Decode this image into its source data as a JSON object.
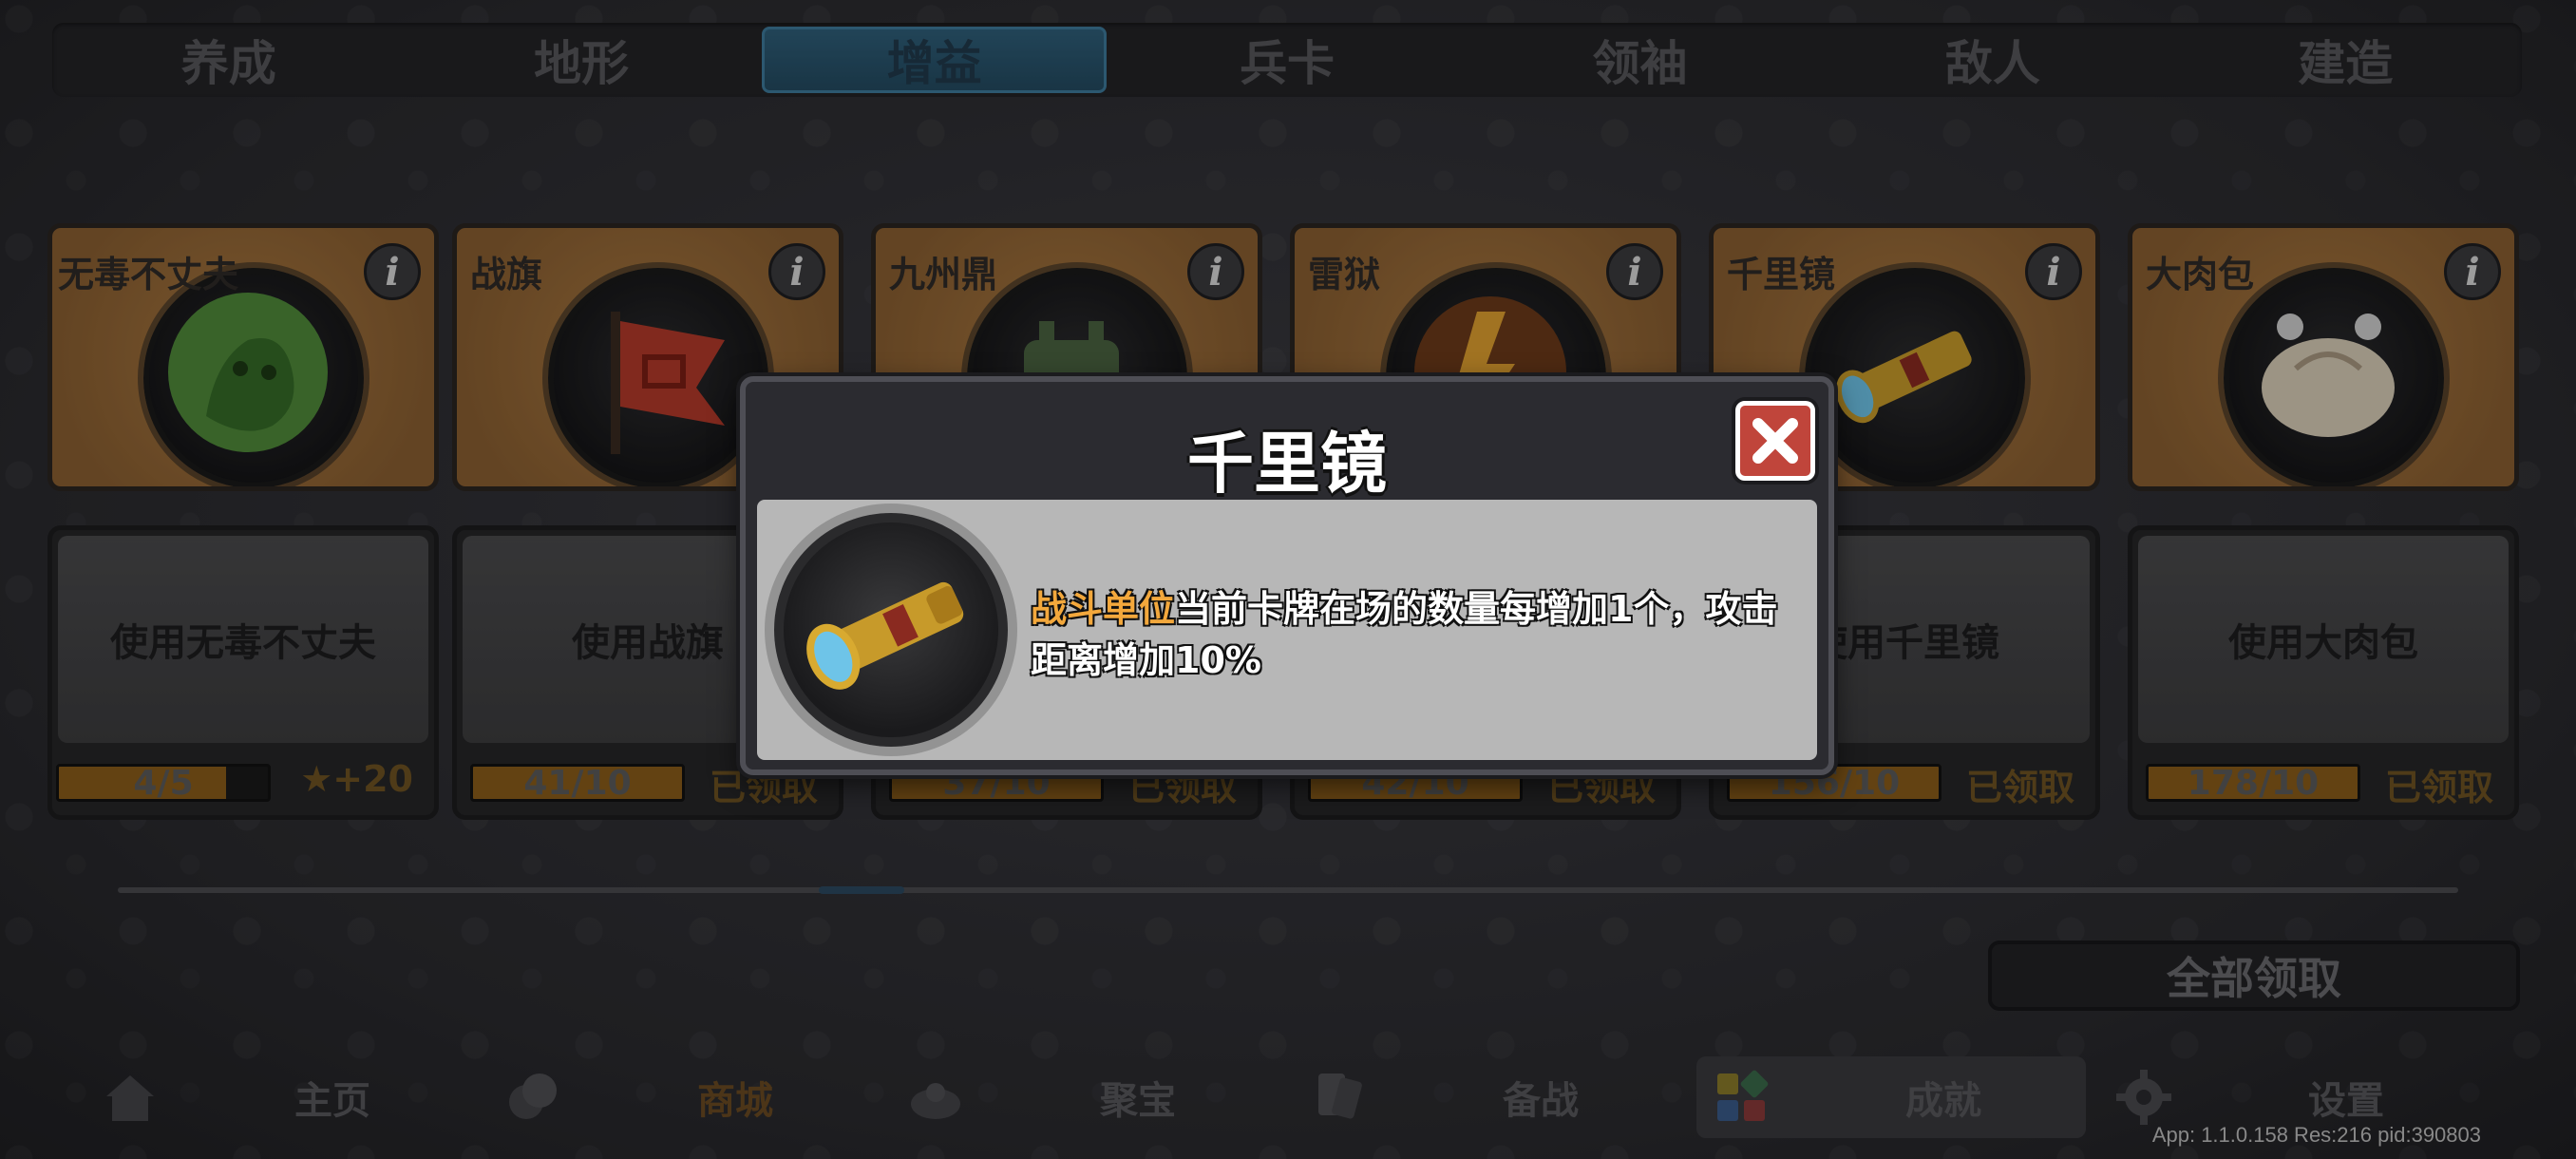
{
  "tabs": [
    {
      "label": "养成"
    },
    {
      "label": "地形"
    },
    {
      "label": "增益",
      "active": true
    },
    {
      "label": "兵卡"
    },
    {
      "label": "领袖"
    },
    {
      "label": "敌人"
    },
    {
      "label": "建造"
    }
  ],
  "cards": [
    {
      "name": "无毒不丈夫",
      "use_label": "使用无毒不丈夫",
      "progress_text": "4/5",
      "progress": 0.8,
      "reward": "+20",
      "status": ""
    },
    {
      "name": "战旗",
      "use_label": "使用战旗",
      "progress_text": "41/10",
      "progress": 1.0,
      "status": "已领取"
    },
    {
      "name": "九州鼎",
      "use_label": "",
      "progress_text": "37/10",
      "progress": 1.0,
      "status": "已领取"
    },
    {
      "name": "雷狱",
      "use_label": "",
      "progress_text": "42/10",
      "progress": 1.0,
      "status": "已领取"
    },
    {
      "name": "千里镜",
      "use_label": "使用千里镜",
      "progress_text": "156/10",
      "progress": 1.0,
      "status": "已领取"
    },
    {
      "name": "大肉包",
      "use_label": "使用大肉包",
      "progress_text": "178/10",
      "progress": 1.0,
      "status": "已领取"
    }
  ],
  "info_glyph": "i",
  "claim_all_label": "全部领取",
  "scroll_progress": 0.32,
  "bottom_nav": [
    {
      "label": "主页",
      "icon": "home-icon"
    },
    {
      "label": "商城",
      "icon": "coins-icon"
    },
    {
      "label": "聚宝",
      "icon": "treasure-icon"
    },
    {
      "label": "备战",
      "icon": "cards-icon"
    },
    {
      "label": "成就",
      "icon": "achievement-icon",
      "active": true
    },
    {
      "label": "设置",
      "icon": "gear-icon"
    }
  ],
  "version_text": "App: 1.1.0.158 Res:216 pid:390803",
  "modal": {
    "title": "千里镜",
    "desc_highlight": "战斗单位",
    "desc_rest": "当前卡牌在场的数量每增加1个，攻击距离增加10%",
    "close_icon": "close-icon"
  },
  "colors": {
    "accent_orange": "#f3a83c",
    "active_tab": "#2f5f7a",
    "close_red": "#c0453b",
    "card_bronze": "#a7773f"
  }
}
